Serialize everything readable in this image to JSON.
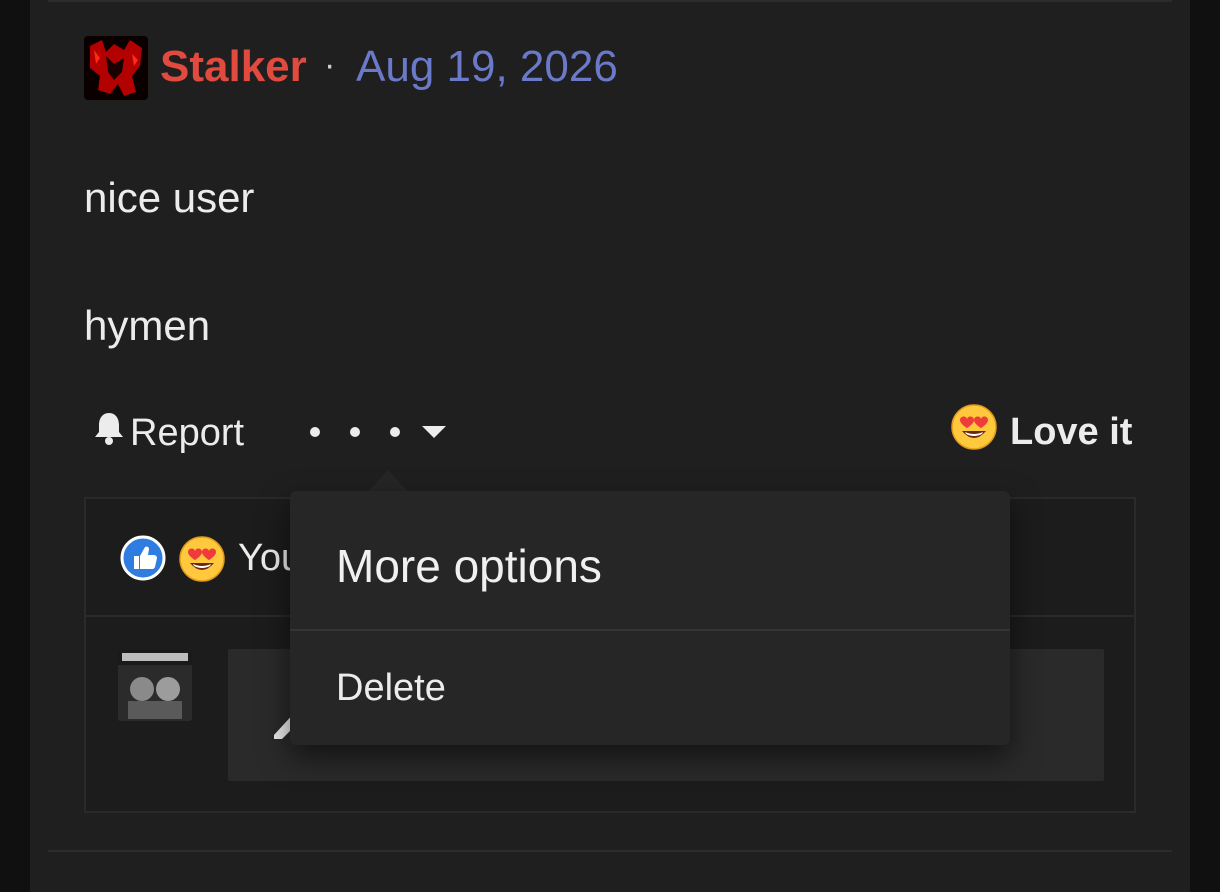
{
  "post": {
    "author": "Stalker",
    "separator": "·",
    "date": "Aug 19, 2026",
    "body_lines": [
      "nice user",
      "hymen"
    ]
  },
  "actions": {
    "report_label": "Report",
    "love_label": "Love it"
  },
  "reactions": {
    "summary_text": "You",
    "icons": [
      "thumbs-up-icon",
      "heart-eyes-icon"
    ]
  },
  "dropdown": {
    "title": "More options",
    "items": [
      "Delete"
    ]
  },
  "colors": {
    "author": "#e04a3f",
    "date": "#6b79c9",
    "background": "#1f1f1f"
  }
}
